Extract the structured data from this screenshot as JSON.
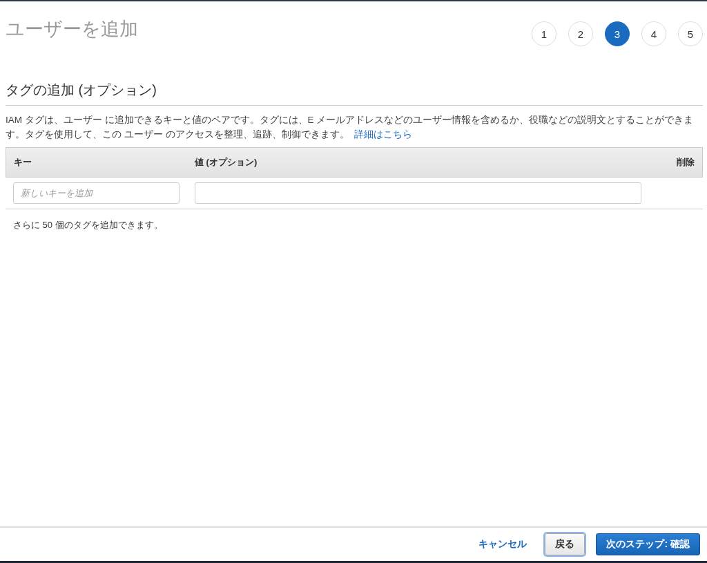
{
  "page": {
    "title": "ユーザーを追加"
  },
  "steps": [
    {
      "label": "1",
      "selected": false
    },
    {
      "label": "2",
      "selected": false
    },
    {
      "label": "3",
      "selected": true
    },
    {
      "label": "4",
      "selected": false
    },
    {
      "label": "5",
      "selected": false
    }
  ],
  "section": {
    "title": "タグの追加 (オプション)",
    "description": "IAM タグは、ユーザー に追加できるキーと値のペアです。タグには、E メールアドレスなどのユーザー情報を含めるか、役職などの説明文とすることができます。タグを使用して、この ユーザー のアクセスを整理、追跡、制御できます。",
    "link": "詳細はこちら"
  },
  "table": {
    "columns": [
      "キー",
      "値 (オプション)",
      "削除"
    ],
    "new_row": {
      "key_placeholder": "新しいキーを追加"
    },
    "remaining": "さらに 50 個のタグを追加できます。"
  },
  "footer": {
    "cancel": "キャンセル",
    "back": "戻る",
    "next": "次のステップ: 確認"
  }
}
